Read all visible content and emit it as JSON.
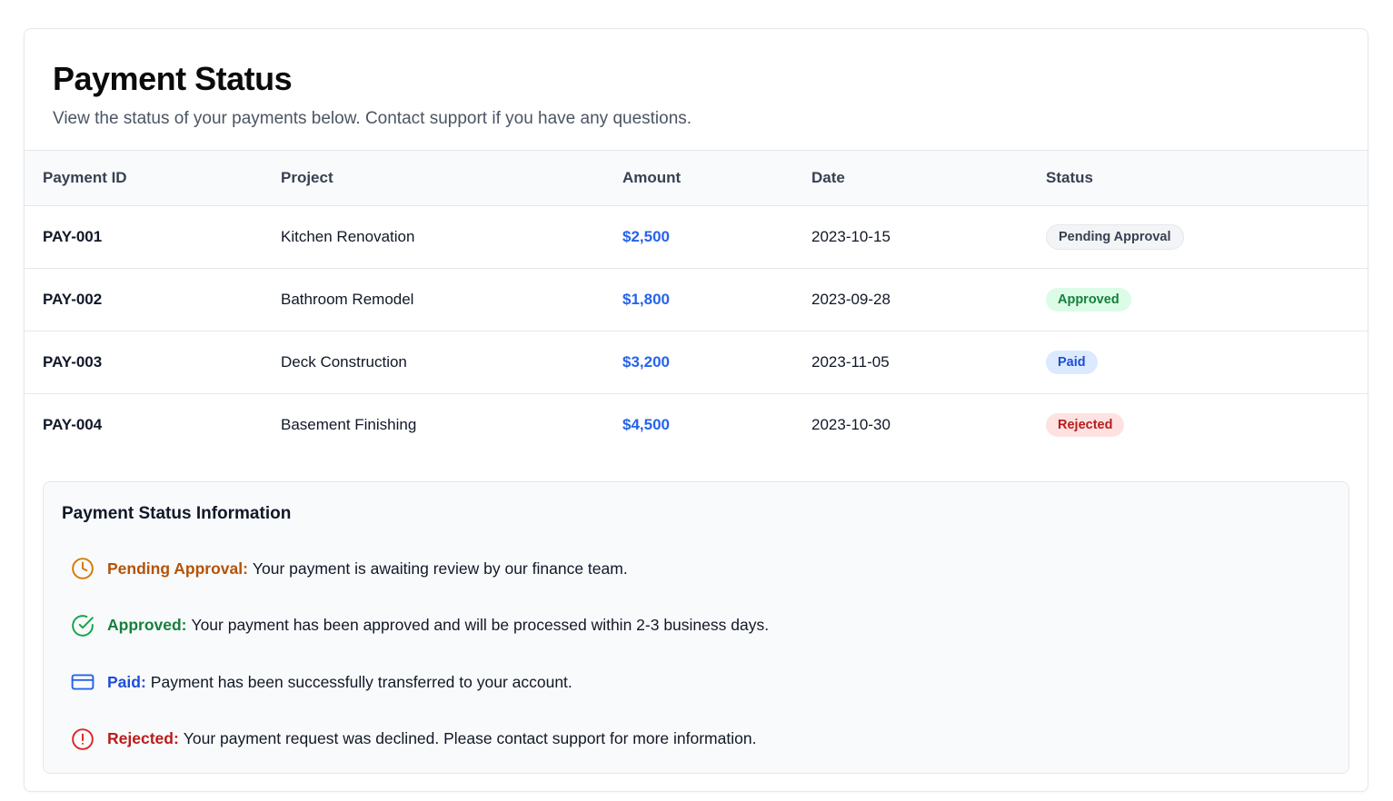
{
  "header": {
    "title": "Payment Status",
    "subtitle": "View the status of your payments below. Contact support if you have any questions."
  },
  "table": {
    "columns": [
      "Payment ID",
      "Project",
      "Amount",
      "Date",
      "Status"
    ],
    "rows": [
      {
        "id": "PAY-001",
        "project": "Kitchen Renovation",
        "amount": "$2,500",
        "date": "2023-10-15",
        "status": "Pending Approval"
      },
      {
        "id": "PAY-002",
        "project": "Bathroom Remodel",
        "amount": "$1,800",
        "date": "2023-09-28",
        "status": "Approved"
      },
      {
        "id": "PAY-003",
        "project": "Deck Construction",
        "amount": "$3,200",
        "date": "2023-11-05",
        "status": "Paid"
      },
      {
        "id": "PAY-004",
        "project": "Basement Finishing",
        "amount": "$4,500",
        "date": "2023-10-30",
        "status": "Rejected"
      }
    ]
  },
  "info": {
    "title": "Payment Status Information",
    "items": [
      {
        "icon": "clock-icon",
        "label": "Pending Approval:",
        "description": "Your payment is awaiting review by our finance team.",
        "color": "#d97706"
      },
      {
        "icon": "check-circle-icon",
        "label": "Approved:",
        "description": "Your payment has been approved and will be processed within 2-3 business days.",
        "color": "#16a34a"
      },
      {
        "icon": "credit-card-icon",
        "label": "Paid:",
        "description": "Payment has been successfully transferred to your account.",
        "color": "#2563eb"
      },
      {
        "icon": "alert-circle-icon",
        "label": "Rejected:",
        "description": "Your payment request was declined. Please contact support for more information.",
        "color": "#dc2626"
      }
    ]
  },
  "colors": {
    "accent": "#2563eb",
    "pending": "#d97706",
    "approved": "#16a34a",
    "paid": "#2563eb",
    "rejected": "#dc2626"
  }
}
